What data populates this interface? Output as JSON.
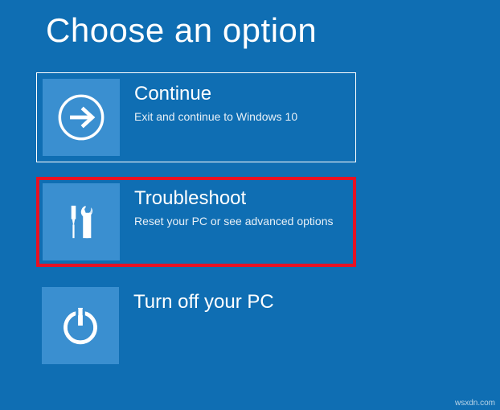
{
  "title": "Choose an option",
  "options": [
    {
      "id": "continue",
      "title": "Continue",
      "desc": "Exit and continue to Windows 10",
      "icon": "arrow-right-icon",
      "highlight": "white"
    },
    {
      "id": "troubleshoot",
      "title": "Troubleshoot",
      "desc": "Reset your PC or see advanced options",
      "icon": "tools-icon",
      "highlight": "red"
    },
    {
      "id": "turnoff",
      "title": "Turn off your PC",
      "desc": "",
      "icon": "power-icon",
      "highlight": "none"
    }
  ],
  "watermark": "wsxdn.com"
}
